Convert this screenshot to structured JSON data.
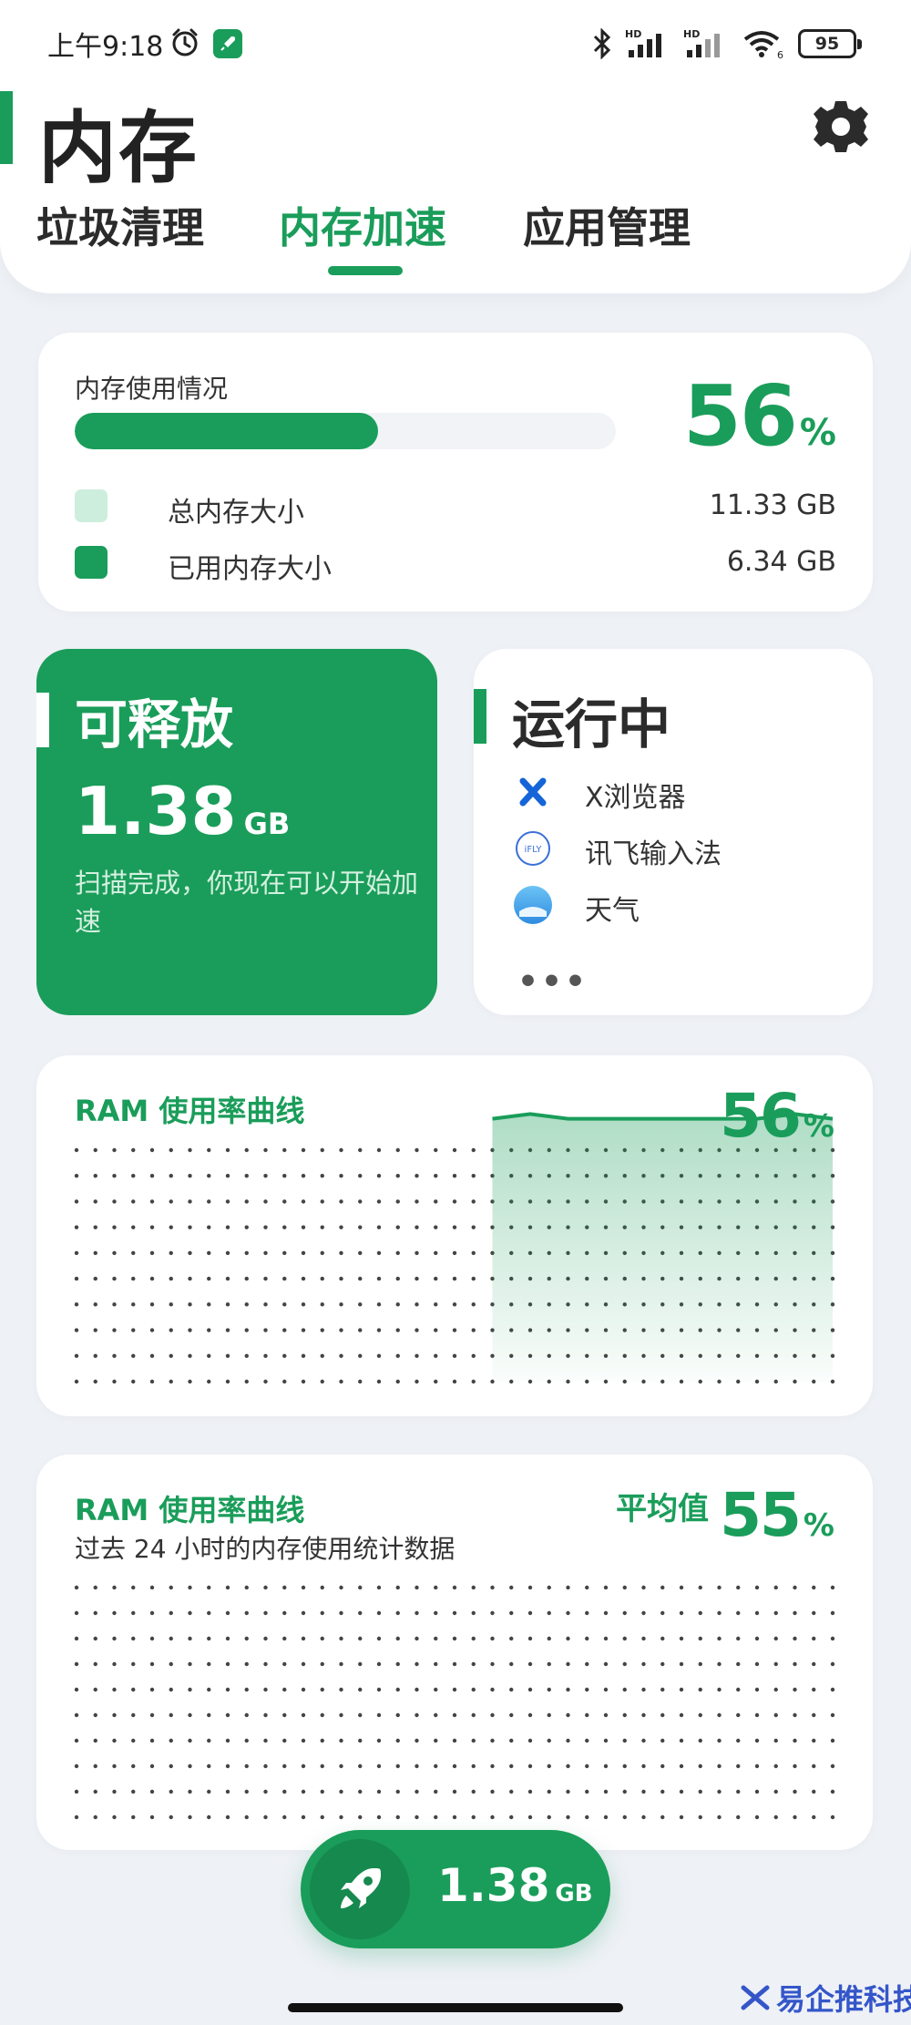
{
  "status_bar": {
    "time": "上午9:18",
    "battery": "95",
    "network_labels": [
      "HD",
      "HD"
    ],
    "wifi_badge": "6"
  },
  "header": {
    "title": "内存",
    "tabs": [
      {
        "label": "垃圾清理"
      },
      {
        "label": "内存加速"
      },
      {
        "label": "应用管理"
      }
    ],
    "active_tab": 1
  },
  "usage": {
    "label": "内存使用情况",
    "percent": "56",
    "percent_sign": "%",
    "fill_fraction": 0.56,
    "legend": [
      {
        "label": "总内存大小",
        "value": "11.33 GB",
        "color": "#cdeedd"
      },
      {
        "label": "已用内存大小",
        "value": "6.34 GB",
        "color": "#1a9d5a"
      }
    ]
  },
  "release": {
    "title": "可释放",
    "size": "1.38",
    "unit": "GB",
    "note": "扫描完成，你现在可以开始加速"
  },
  "running": {
    "title": "运行中",
    "apps": [
      {
        "label": "X浏览器",
        "icon": "x-browser-icon"
      },
      {
        "label": "讯飞输入法",
        "icon": "ifly-icon"
      },
      {
        "label": "天气",
        "icon": "weather-icon"
      }
    ],
    "more": "•••"
  },
  "chart_realtime": {
    "title": "RAM 使用率曲线",
    "percent": "56",
    "percent_sign": "%"
  },
  "chart_24h": {
    "title": "RAM 使用率曲线",
    "subtitle": "过去 24 小时的内存使用统计数据",
    "avg_label": "平均值",
    "percent": "55",
    "percent_sign": "%"
  },
  "chart_data": [
    {
      "type": "area",
      "title": "RAM 使用率曲线",
      "ylim": [
        0,
        100
      ],
      "x": [
        0,
        1,
        2,
        3,
        4,
        5,
        6,
        7,
        8,
        9,
        10,
        11,
        12,
        13,
        14,
        15,
        16,
        17,
        18,
        19,
        20
      ],
      "series": [
        {
          "values": [
            null,
            null,
            null,
            null,
            null,
            null,
            null,
            null,
            null,
            null,
            null,
            56,
            57,
            56,
            56,
            56,
            56,
            56,
            56,
            57,
            56
          ]
        }
      ],
      "grid": "dots"
    },
    {
      "type": "area",
      "title": "RAM 使用率曲线",
      "ylim": [
        0,
        100
      ],
      "series": [],
      "grid": "dots"
    }
  ],
  "boost": {
    "size": "1.38",
    "unit": "GB"
  },
  "colors": {
    "accent": "#1a9d5a",
    "background": "#eef1f6"
  },
  "watermark": {
    "text": "易企推科技"
  }
}
